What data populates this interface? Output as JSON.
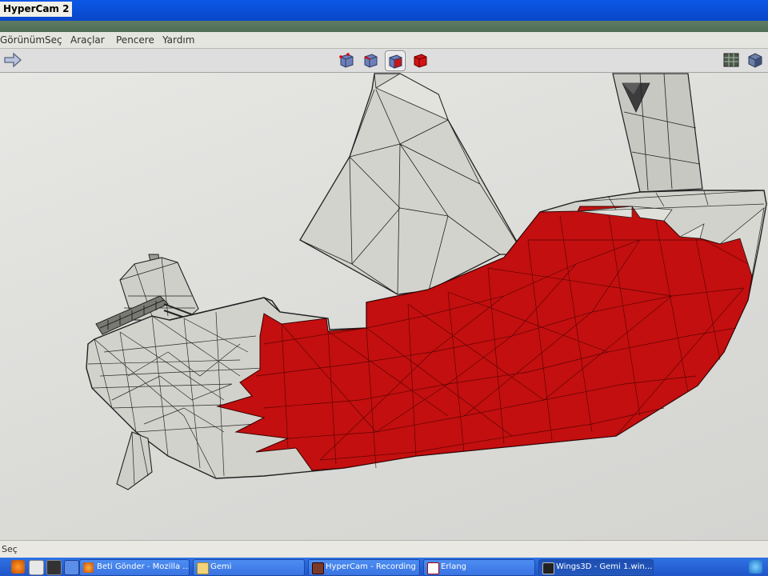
{
  "window": {
    "title": "HyperCam 2"
  },
  "menu": {
    "items": [
      {
        "label": "Görünüm"
      },
      {
        "label": "Seç"
      },
      {
        "label": "Araçlar"
      },
      {
        "label": "Pencere"
      },
      {
        "label": "Yardım"
      }
    ]
  },
  "toolbar": {
    "buttons": [
      {
        "icon": "redo-arrow-icon"
      },
      {
        "icon": "vertex-select-mode-icon"
      },
      {
        "icon": "edge-select-mode-icon"
      },
      {
        "icon": "face-select-mode-icon",
        "active": true
      },
      {
        "icon": "body-select-mode-icon"
      },
      {
        "icon": "grid-view-icon"
      },
      {
        "icon": "shaded-cube-icon"
      }
    ]
  },
  "status": {
    "text": "Seç"
  },
  "taskbar": {
    "tasks": [
      {
        "label": "Beti Gönder - Mozilla ...",
        "icon": "firefox-icon"
      },
      {
        "label": "Gemi",
        "icon": "folder-icon"
      },
      {
        "label": "HyperCam - Recording",
        "icon": "hypercam-icon"
      },
      {
        "label": "Erlang",
        "icon": "erlang-icon"
      },
      {
        "label": "Wings3D - Gemi 1.win...",
        "icon": "wings3d-icon",
        "active": true
      }
    ]
  },
  "colors": {
    "selection": "#c20e0e",
    "mesh": "#d6d6d0",
    "titlebar": "#0a50d8",
    "taskbar": "#2a66dc"
  }
}
